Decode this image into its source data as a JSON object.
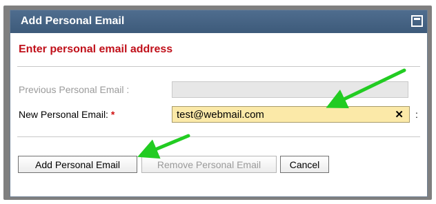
{
  "dialog": {
    "title": "Add Personal Email",
    "heading": "Enter personal email address",
    "previous_label": "Previous Personal Email :",
    "previous_value": "",
    "new_label": "New Personal Email:",
    "required_marker": "*",
    "new_value": "test@webmail.com",
    "clear_glyph": "✕",
    "trailing_colon": ":",
    "buttons": {
      "add": "Add Personal Email",
      "remove": "Remove Personal Email",
      "cancel": "Cancel"
    }
  },
  "icons": {
    "maximize": "maximize-icon",
    "annotation_arrows": "arrow-icon"
  },
  "colors": {
    "titlebar": "#46627f",
    "heading": "#c0101a",
    "input_highlight": "#fbe9a8",
    "arrow": "#22cc22"
  }
}
